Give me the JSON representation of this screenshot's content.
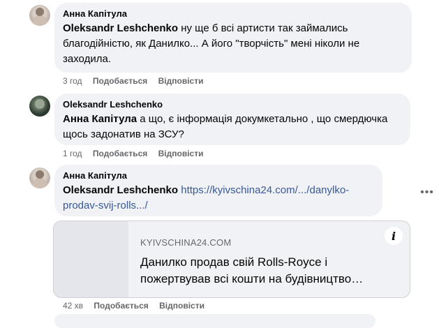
{
  "comments": [
    {
      "author": "Анна Капітула",
      "mention": "Oleksandr Leshchenko",
      "text": "ну ще б всі артисти так займались благодійністю, як Данилко... А його \"творчість\" мені ніколи не заходила.",
      "time": "3 год",
      "like_label": "Подобається",
      "reply_label": "Відповісти"
    },
    {
      "author": "Oleksandr Leshchenko",
      "mention": "Анна Капітула",
      "text": "а що, є інформація докумкетально , що смердючка щось задонатив на ЗСУ?",
      "time": "1 год",
      "like_label": "Подобається",
      "reply_label": "Відповісти"
    },
    {
      "author": "Анна Капітула",
      "mention": "Oleksandr Leshchenko",
      "link": "https://kyivschina24.com/.../danylko-prodav-svij-rolls.../",
      "time": "42 хв",
      "like_label": "Подобається",
      "reply_label": "Відповісти",
      "preview": {
        "domain": "KYIVSCHINA24.COM",
        "title": "Данилко продав свій Rolls-Royce і пожертвував всі кошти на будівництво…"
      }
    }
  ],
  "icons": {
    "info": "i",
    "more": "•••"
  }
}
